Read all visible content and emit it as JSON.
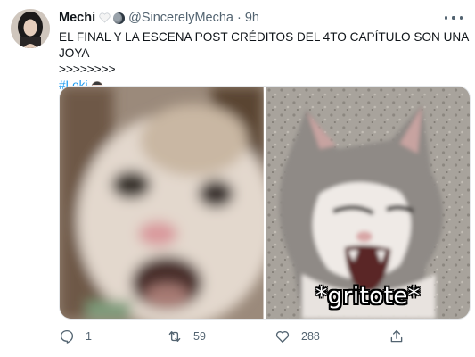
{
  "tweet": {
    "display_name": "Mechi",
    "handle": "@SincerelyMecha",
    "separator": "·",
    "time": "9h",
    "text_line1": "EL FINAL Y LA ESCENA POST CRÉDITOS DEL 4TO CAPÍTULO SON UNA JOYA",
    "text_line2": ">>>>>>>>",
    "hashtag": "#Loki"
  },
  "media": {
    "images": [
      {
        "description": "blurred-cat"
      },
      {
        "description": "screaming-cat",
        "caption": "*gritote*"
      }
    ]
  },
  "actions": {
    "reply_count": "1",
    "retweet_count": "59",
    "like_count": "288"
  },
  "icons": {
    "more": "more-icon",
    "reply": "reply-icon",
    "retweet": "retweet-icon",
    "like": "heart-icon",
    "share": "share-icon"
  },
  "colors": {
    "text": "#0f1419",
    "secondary": "#536471",
    "link": "#1d9bf0"
  }
}
